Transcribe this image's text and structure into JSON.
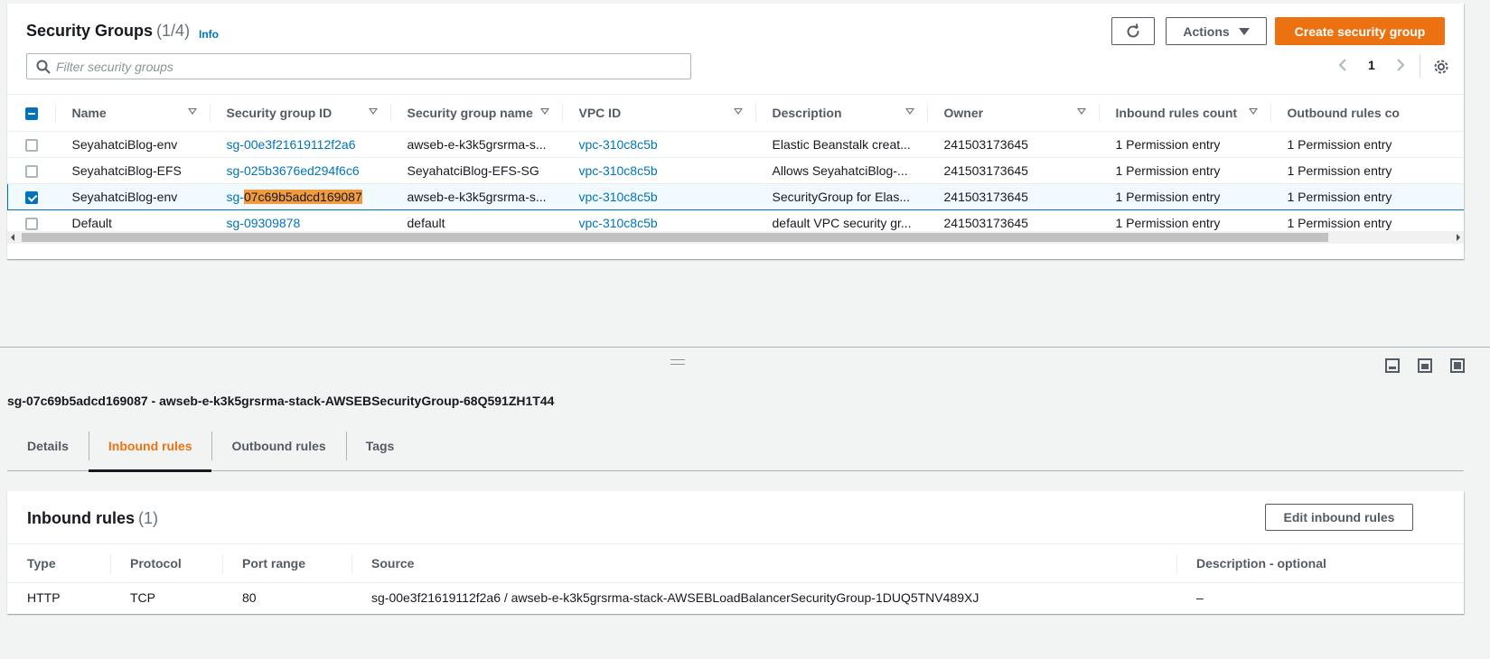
{
  "header": {
    "title": "Security Groups",
    "count": "(1/4)",
    "info": "Info",
    "actions_label": "Actions",
    "create_label": "Create security group",
    "search_placeholder": "Filter security groups",
    "page_number": "1"
  },
  "colors": {
    "accent": "#ec7211",
    "link": "#0073bb",
    "highlight": "#f19a3e"
  },
  "icons": [
    "refresh-icon",
    "caret-down-icon",
    "search-icon",
    "chevron-left-icon",
    "chevron-right-icon",
    "gear-icon"
  ],
  "table": {
    "columns": [
      "Name",
      "Security group ID",
      "Security group name",
      "VPC ID",
      "Description",
      "Owner",
      "Inbound rules count",
      "Outbound rules co"
    ],
    "rows": [
      {
        "selected": false,
        "name": "SeyahatciBlog-env",
        "sg_id_prefix": "sg-00e3f21619112f2a6",
        "sg_id_highlight": "",
        "sg_name": "awseb-e-k3k5grsrma-s...",
        "vpc": "vpc-310c8c5b",
        "description": "Elastic Beanstalk creat...",
        "owner": "241503173645",
        "inbound": "1 Permission entry",
        "outbound": "1 Permission entry"
      },
      {
        "selected": false,
        "name": "SeyahatciBlog-EFS",
        "sg_id_prefix": "sg-025b3676ed294f6c6",
        "sg_id_highlight": "",
        "sg_name": "SeyahatciBlog-EFS-SG",
        "vpc": "vpc-310c8c5b",
        "description": "Allows SeyahatciBlog-...",
        "owner": "241503173645",
        "inbound": "1 Permission entry",
        "outbound": "1 Permission entry"
      },
      {
        "selected": true,
        "name": "SeyahatciBlog-env",
        "sg_id_prefix": "sg-",
        "sg_id_highlight": "07c69b5adcd169087",
        "sg_name": "awseb-e-k3k5grsrma-s...",
        "vpc": "vpc-310c8c5b",
        "description": "SecurityGroup for Elas...",
        "owner": "241503173645",
        "inbound": "1 Permission entry",
        "outbound": "1 Permission entry"
      },
      {
        "selected": false,
        "name": "Default",
        "sg_id_prefix": "sg-09309878",
        "sg_id_highlight": "",
        "sg_name": "default",
        "vpc": "vpc-310c8c5b",
        "description": "default VPC security gr...",
        "owner": "241503173645",
        "inbound": "1 Permission entry",
        "outbound": "1 Permission entry"
      }
    ]
  },
  "detail": {
    "title": "sg-07c69b5adcd169087 - awseb-e-k3k5grsrma-stack-AWSEBSecurityGroup-68Q591ZH1T44",
    "tabs": [
      {
        "label": "Details",
        "active": false
      },
      {
        "label": "Inbound rules",
        "active": true
      },
      {
        "label": "Outbound rules",
        "active": false
      },
      {
        "label": "Tags",
        "active": false
      }
    ],
    "inbound": {
      "title": "Inbound rules",
      "count": "(1)",
      "edit_label": "Edit inbound rules",
      "columns": [
        "Type",
        "Protocol",
        "Port range",
        "Source",
        "Description - optional"
      ],
      "rows": [
        [
          "HTTP",
          "TCP",
          "80",
          "sg-00e3f21619112f2a6 / awseb-e-k3k5grsrma-stack-AWSEBLoadBalancerSecurityGroup-1DUQ5TNV489XJ",
          "–"
        ]
      ]
    }
  }
}
